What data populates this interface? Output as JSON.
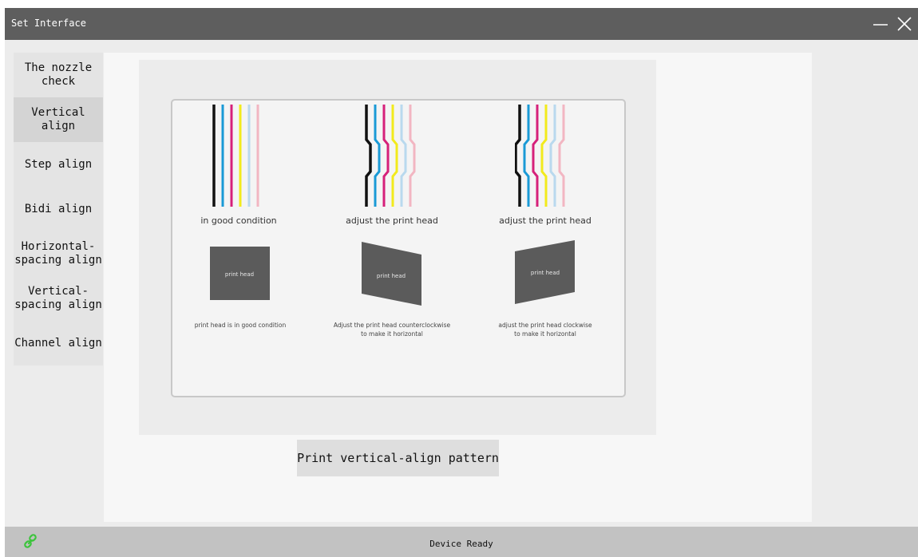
{
  "window": {
    "title": "Set Interface",
    "minimize_icon": "minimize-icon",
    "close_icon": "close-icon"
  },
  "sidebar": {
    "items": [
      {
        "label": "The nozzle\ncheck"
      },
      {
        "label": "Vertical\nalign",
        "active": true
      },
      {
        "label": "Step align"
      },
      {
        "label": "Bidi align"
      },
      {
        "label": "Horizontal-\nspacing align"
      },
      {
        "label": "Vertical-\nspacing align"
      },
      {
        "label": "Channel align"
      }
    ]
  },
  "illustration": {
    "line_colors": [
      "#111111",
      "#1a9ad6",
      "#d6207a",
      "#f2ea1c",
      "#b9d9ee",
      "#f2b6c2"
    ],
    "columns": [
      {
        "caption": "in good condition",
        "head_label": "print head",
        "head_caption": "print head is in good condition"
      },
      {
        "caption": "adjust  the print head",
        "head_label": "print head",
        "head_caption": "Adjust the print head counterclockwise\nto make it horizontal"
      },
      {
        "caption": "adjust the print head",
        "head_label": "print head",
        "head_caption": "adjust the print head clockwise\nto make it horizontal"
      }
    ]
  },
  "actions": {
    "print_pattern_label": "Print vertical-align pattern"
  },
  "status": {
    "text": "Device Ready",
    "connection_icon": "link-icon",
    "connection_color": "#3cc43c"
  }
}
